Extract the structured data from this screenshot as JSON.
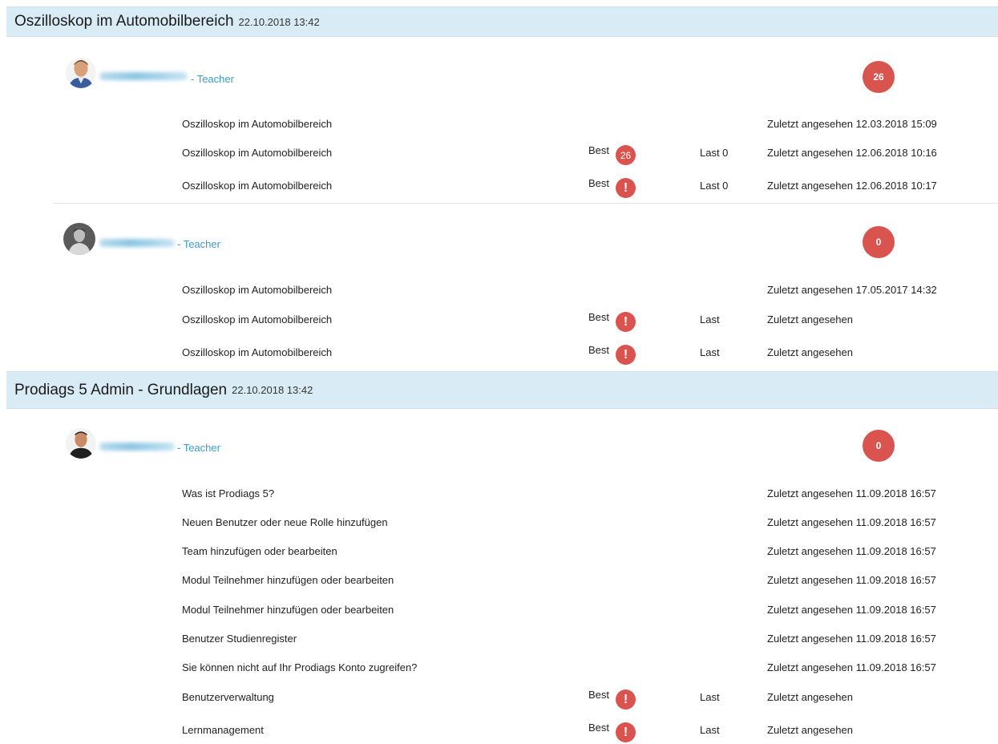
{
  "courses": [
    {
      "title": "Oszilloskop im Automobilbereich",
      "date": "22.10.2018 13:42",
      "users": [
        {
          "role": "- Teacher",
          "count": "26",
          "items": [
            {
              "title": "Oszilloskop im Automobilbereich",
              "best": "",
              "best_badge": "",
              "last": "",
              "viewed": "Zuletzt angesehen 12.03.2018 15:09"
            },
            {
              "title": "Oszilloskop im Automobilbereich",
              "best": "Best",
              "best_badge": "26",
              "last": "Last 0",
              "viewed": "Zuletzt angesehen 12.06.2018 10:16"
            },
            {
              "title": "Oszilloskop im Automobilbereich",
              "best": "Best",
              "best_badge": "!",
              "last": "Last 0",
              "viewed": "Zuletzt angesehen 12.06.2018 10:17"
            }
          ]
        },
        {
          "role": "- Teacher",
          "count": "0",
          "items": [
            {
              "title": "Oszilloskop im Automobilbereich",
              "best": "",
              "best_badge": "",
              "last": "",
              "viewed": "Zuletzt angesehen 17.05.2017 14:32"
            },
            {
              "title": "Oszilloskop im Automobilbereich",
              "best": "Best",
              "best_badge": "!",
              "last": "Last",
              "viewed": "Zuletzt angesehen"
            },
            {
              "title": "Oszilloskop im Automobilbereich",
              "best": "Best",
              "best_badge": "!",
              "last": "Last",
              "viewed": "Zuletzt angesehen"
            }
          ]
        }
      ]
    },
    {
      "title": "Prodiags 5 Admin - Grundlagen",
      "date": "22.10.2018 13:42",
      "users": [
        {
          "role": "- Teacher",
          "count": "0",
          "items": [
            {
              "title": "Was ist Prodiags 5?",
              "best": "",
              "best_badge": "",
              "last": "",
              "viewed": "Zuletzt angesehen 11.09.2018 16:57"
            },
            {
              "title": "Neuen Benutzer oder neue Rolle hinzufügen",
              "best": "",
              "best_badge": "",
              "last": "",
              "viewed": "Zuletzt angesehen 11.09.2018 16:57"
            },
            {
              "title": "Team hinzufügen oder bearbeiten",
              "best": "",
              "best_badge": "",
              "last": "",
              "viewed": "Zuletzt angesehen 11.09.2018 16:57"
            },
            {
              "title": "Modul Teilnehmer hinzufügen oder bearbeiten",
              "best": "",
              "best_badge": "",
              "last": "",
              "viewed": "Zuletzt angesehen 11.09.2018 16:57"
            },
            {
              "title": "Modul Teilnehmer hinzufügen oder bearbeiten",
              "best": "",
              "best_badge": "",
              "last": "",
              "viewed": "Zuletzt angesehen 11.09.2018 16:57"
            },
            {
              "title": "Benutzer Studienregister",
              "best": "",
              "best_badge": "",
              "last": "",
              "viewed": "Zuletzt angesehen 11.09.2018 16:57"
            },
            {
              "title": "Sie können nicht auf Ihr Prodiags Konto zugreifen?",
              "best": "",
              "best_badge": "",
              "last": "",
              "viewed": "Zuletzt angesehen 11.09.2018 16:57"
            },
            {
              "title": "Benutzerverwaltung",
              "best": "Best",
              "best_badge": "!",
              "last": "Last",
              "viewed": "Zuletzt angesehen"
            },
            {
              "title": "Lernmanagement",
              "best": "Best",
              "best_badge": "!",
              "last": "Last",
              "viewed": "Zuletzt angesehen"
            }
          ]
        }
      ]
    }
  ],
  "colors": {
    "header_bg": "#d9ebf5",
    "badge_red": "#d9534f",
    "role_link": "#3a9cc7"
  }
}
